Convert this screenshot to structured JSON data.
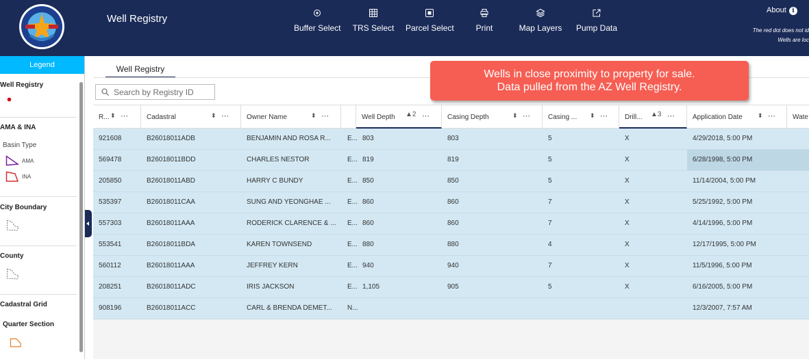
{
  "header": {
    "title": "Well Registry",
    "tools": [
      {
        "label": "Buffer Select",
        "icon": "buffer-select-icon"
      },
      {
        "label": "TRS Select",
        "icon": "grid-icon"
      },
      {
        "label": "Parcel Select",
        "icon": "parcel-icon"
      },
      {
        "label": "Print",
        "icon": "printer-icon"
      },
      {
        "label": "Map Layers",
        "icon": "layers-icon"
      },
      {
        "label": "Pump Data",
        "icon": "export-icon"
      }
    ],
    "about_label": "About",
    "note_line1": "The red dot does not id",
    "note_line2": "Wells are loc"
  },
  "logo": {
    "text_top": "ARIZONA DEPARTMENT",
    "text_bottom": "WATER RESOURCES",
    "year_left": "EST",
    "year_right": "1980"
  },
  "legend": {
    "header": "Legend",
    "well_registry": "Well Registry",
    "ama_ina": "AMA & INA",
    "basin_type": "Basin Type",
    "ama": "AMA",
    "ina": "INA",
    "city_boundary": "City Boundary",
    "county": "County",
    "cadastral_grid": "Cadastral Grid",
    "quarter_section": "Quarter Section"
  },
  "main": {
    "tab": "Well Registry",
    "search_placeholder": "Search by Registry ID"
  },
  "callout": {
    "line1": "Wells in close proximity to property for sale.",
    "line2": "Data pulled from the AZ Well Registry."
  },
  "table": {
    "columns": [
      {
        "label": "R...",
        "sort": "⬍",
        "more": "⋯"
      },
      {
        "label": "Cadastral",
        "sort": "⬍",
        "more": "⋯"
      },
      {
        "label": "Owner Name",
        "sort": "⬍",
        "more": "⋯"
      },
      {
        "label": "",
        "sort": "",
        "more": ""
      },
      {
        "label": "Well Depth",
        "sort": "▲2",
        "more": "⋯"
      },
      {
        "label": "Casing Depth",
        "sort": "⬍",
        "more": "⋯"
      },
      {
        "label": "Casing ...",
        "sort": "⬍",
        "more": "⋯"
      },
      {
        "label": "Drill...",
        "sort": "▲3",
        "more": "⋯"
      },
      {
        "label": "Application Date",
        "sort": "⬍",
        "more": "⋯"
      },
      {
        "label": "Wate",
        "sort": "",
        "more": ""
      }
    ],
    "rows": [
      [
        "921608",
        "B26018011ADB",
        "BENJAMIN AND ROSA R...",
        "E...",
        "803",
        "803",
        "5",
        "X",
        "4/29/2018, 5:00 PM"
      ],
      [
        "569478",
        "B26018011BDD",
        "CHARLES NESTOR",
        "E...",
        "819",
        "819",
        "5",
        "X",
        "6/28/1998, 5:00 PM"
      ],
      [
        "205850",
        "B26018011ABD",
        "HARRY C BUNDY",
        "E...",
        "850",
        "850",
        "5",
        "X",
        "11/14/2004, 5:00 PM"
      ],
      [
        "535397",
        "B26018011CAA",
        "SUNG AND YEONGHAE ...",
        "E...",
        "860",
        "860",
        "7",
        "X",
        "5/25/1992, 5:00 PM"
      ],
      [
        "557303",
        "B26018011AAA",
        "RODERICK CLARENCE & ...",
        "E...",
        "860",
        "860",
        "7",
        "X",
        "4/14/1996, 5:00 PM"
      ],
      [
        "553541",
        "B26018011BDA",
        "KAREN TOWNSEND",
        "E...",
        "880",
        "880",
        "4",
        "X",
        "12/17/1995, 5:00 PM"
      ],
      [
        "560112",
        "B26018011AAA",
        "JEFFREY KERN",
        "E...",
        "940",
        "940",
        "7",
        "X",
        "11/5/1996, 5:00 PM"
      ],
      [
        "208251",
        "B26018011ADC",
        "IRIS JACKSON",
        "E...",
        "1,105",
        "905",
        "5",
        "X",
        "6/16/2005, 5:00 PM"
      ],
      [
        "908196",
        "B26018011ACC",
        "CARL & BRENDA DEMET...",
        "N...",
        "",
        "",
        "",
        "",
        "12/3/2007, 7:57 AM"
      ]
    ]
  },
  "colors": {
    "header_bg": "#1b2b58",
    "legend_accent": "#00b9ff",
    "row_selected": "#d3e8f3",
    "callout": "#f65e53",
    "ama_outline": "#7b1fa2",
    "ina_outline": "#d32f2f",
    "quarter_outline": "#e67e22"
  }
}
